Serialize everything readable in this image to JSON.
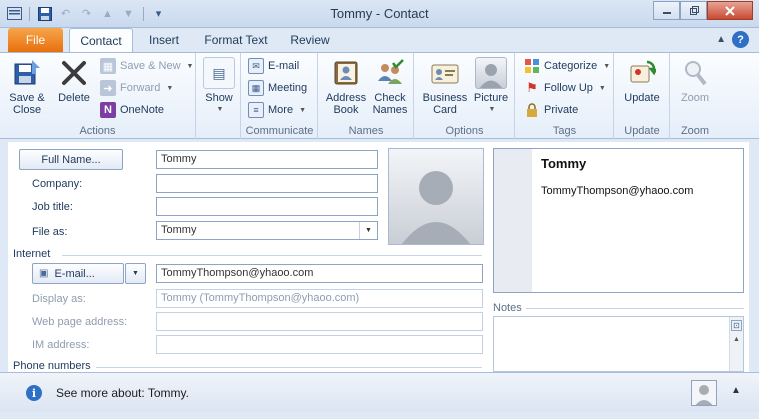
{
  "window": {
    "title": "Tommy  -  Contact",
    "controls": {
      "minimize": "▭",
      "restore": "▢",
      "close": "✕"
    }
  },
  "quick_access": {
    "save_icon": "floppy-disk-icon",
    "undo_icon": "undo-icon",
    "redo_icon": "redo-icon"
  },
  "tabs": [
    {
      "label": "File"
    },
    {
      "label": "Contact"
    },
    {
      "label": "Insert"
    },
    {
      "label": "Format Text"
    },
    {
      "label": "Review"
    }
  ],
  "ribbon": {
    "actions": {
      "label": "Actions",
      "save_close": "Save & Close",
      "delete": "Delete",
      "save_new": "Save & New",
      "forward": "Forward",
      "onenote": "OneNote"
    },
    "show": {
      "label": "Show"
    },
    "communicate": {
      "label": "Communicate",
      "email": "E-mail",
      "meeting": "Meeting",
      "more": "More"
    },
    "names": {
      "label": "Names",
      "address_book": "Address Book",
      "check_names": "Check Names"
    },
    "options": {
      "label": "Options",
      "business_card": "Business Card",
      "picture": "Picture"
    },
    "tags": {
      "label": "Tags",
      "categorize": "Categorize",
      "follow_up": "Follow Up",
      "private": "Private"
    },
    "update": {
      "label": "Update",
      "update_btn": "Update"
    },
    "zoom": {
      "label": "Zoom",
      "zoom_btn": "Zoom"
    }
  },
  "form": {
    "full_name_btn": "Full Name...",
    "full_name": "Tommy",
    "company_label": "Company:",
    "company": "",
    "job_title_label": "Job title:",
    "job_title": "",
    "file_as_label": "File as:",
    "file_as": "Tommy",
    "internet_section": "Internet",
    "email_btn": "E-mail...",
    "email": "TommyThompson@yhaoo.com",
    "display_as_label": "Display as:",
    "display_as": "Tommy (TommyThompson@yhaoo.com)",
    "web_label": "Web page address:",
    "web": "",
    "im_label": "IM address:",
    "im": "",
    "phone_section": "Phone numbers",
    "notes_label": "Notes"
  },
  "card": {
    "name": "Tommy",
    "email": "TommyThompson@yhaoo.com"
  },
  "infobar": {
    "text": "See more about: Tommy."
  },
  "colors": {
    "file_tab": "#e8700d",
    "accent": "#2f6fc5"
  }
}
